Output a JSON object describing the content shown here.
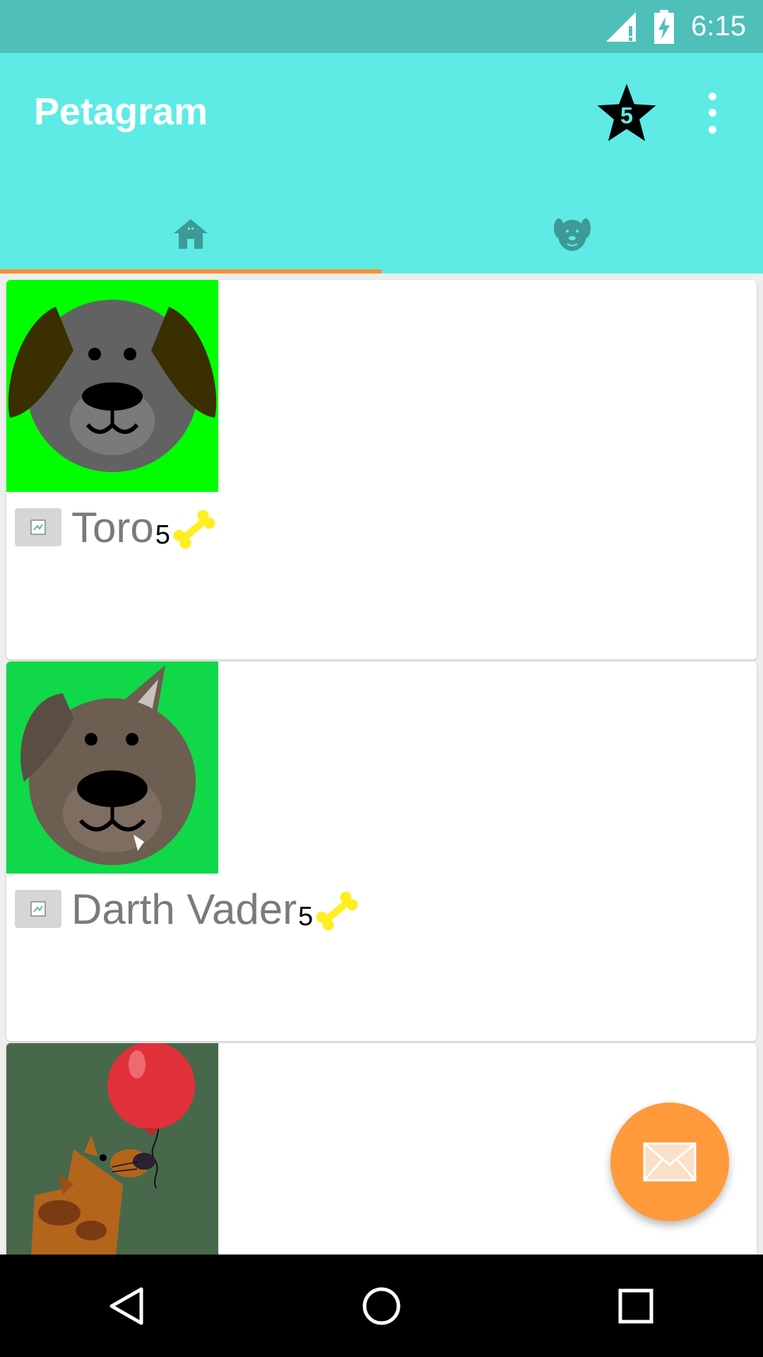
{
  "status_bar": {
    "time": "6:15"
  },
  "app_bar": {
    "title": "Petagram",
    "rating_badge": "5"
  },
  "tabs": [
    {
      "icon": "home-icon",
      "selected": true
    },
    {
      "icon": "dog-face-icon",
      "selected": false
    }
  ],
  "pets": [
    {
      "name": "Toro",
      "likes": "5"
    },
    {
      "name": "Darth Vader",
      "likes": "5"
    },
    {
      "name": "",
      "likes": ""
    }
  ],
  "colors": {
    "status_bar": "#4fbfb9",
    "app_bar": "#5eebe5",
    "tab_indicator": "#ff8f2e",
    "fab": "#ff9a3c",
    "bone": "#ffee22"
  }
}
